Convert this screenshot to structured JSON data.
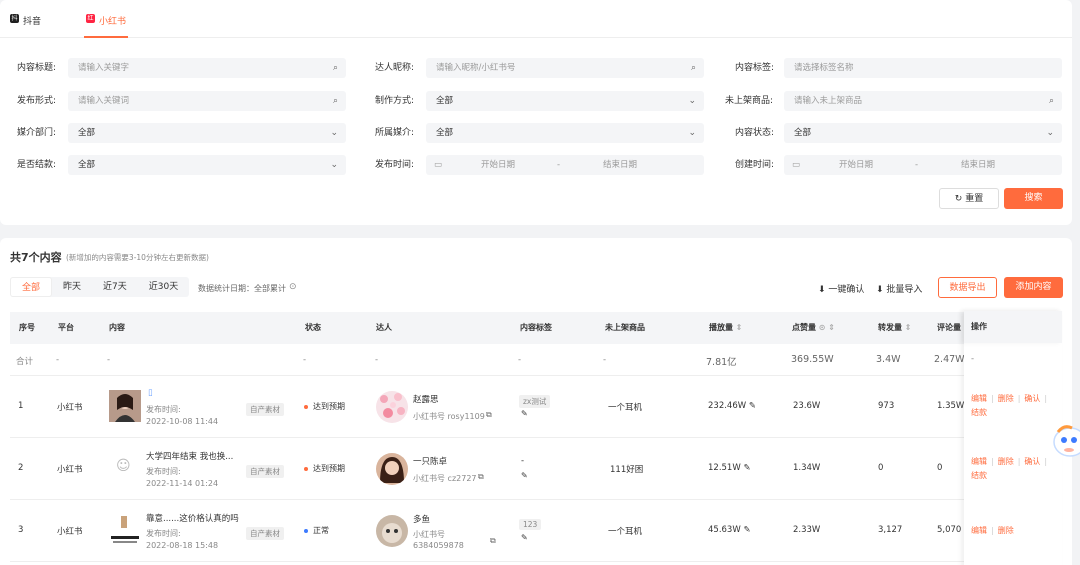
{
  "platform_tabs": [
    {
      "label": "抖音",
      "icon": "douyin-icon",
      "icon_glyph": "抖",
      "color": "#1f1f1f"
    },
    {
      "label": "小红书",
      "icon": "xiaohongshu-icon",
      "icon_glyph": "红",
      "color": "#ff2442"
    }
  ],
  "filters": {
    "content_title": {
      "label": "内容标题:",
      "placeholder": "请输入关键字"
    },
    "creator_name": {
      "label": "达人昵称:",
      "placeholder": "请输入昵称/小红书号"
    },
    "content_tag": {
      "label": "内容标签:",
      "placeholder": "请选择标签名称"
    },
    "publish_form": {
      "label": "发布形式:",
      "placeholder": "请输入关键词"
    },
    "production_method": {
      "label": "制作方式:",
      "value": "全部"
    },
    "unlisted_product": {
      "label": "未上架商品:",
      "placeholder": "请输入未上架商品"
    },
    "media_dept": {
      "label": "媒介部门:",
      "value": "全部"
    },
    "media_owner": {
      "label": "所属媒介:",
      "value": "全部"
    },
    "content_status": {
      "label": "内容状态:",
      "value": "全部"
    },
    "settled": {
      "label": "是否结款:",
      "value": "全部"
    },
    "publish_time": {
      "label": "发布时间:",
      "start": "开始日期",
      "sep": "-",
      "end": "结束日期"
    },
    "create_time": {
      "label": "创建时间:",
      "start": "开始日期",
      "sep": "-",
      "end": "结束日期"
    }
  },
  "actions": {
    "reset": "重置",
    "search": "搜索"
  },
  "summary": {
    "title": "共7个内容",
    "note": "(新增加的内容需要3-10分钟左右更新数据)"
  },
  "date_tabs": [
    "全部",
    "昨天",
    "近7天",
    "近30天"
  ],
  "stats_date": "数据统计日期：全部累计",
  "toolbar": {
    "one_click_confirm": "一键确认",
    "batch_import": "批量导入",
    "export": "数据导出",
    "add": "添加内容"
  },
  "columns": {
    "index": "序号",
    "platform": "平台",
    "content": "内容",
    "status": "状态",
    "creator": "达人",
    "tags": "内容标签",
    "unlisted": "未上架商品",
    "plays": "播放量",
    "likes": "点赞量",
    "shares": "转发量",
    "comments": "评论量",
    "ops": "操作"
  },
  "totals": {
    "label": "合计",
    "platform": "-",
    "content": "-",
    "status": "-",
    "creator": "-",
    "tags": "-",
    "unlisted": "-",
    "plays": "7.81亿",
    "likes": "369.55W",
    "shares": "3.4W",
    "comments": "2.47W",
    "ops": "-"
  },
  "rows": [
    {
      "index": "1",
      "platform": "小红书",
      "title": "",
      "publish_time": "发布时间:",
      "date": "2022-10-08 11:44",
      "source_tag": "自产素材",
      "status": "达到预期",
      "status_color": "#ff6b3d",
      "creator": "赵露思",
      "account": "小红书号 rosy1109",
      "tag": "zx测试",
      "unlisted": "一个耳机",
      "plays": "232.46W",
      "likes": "23.6W",
      "shares": "973",
      "comments": "1.35W",
      "ops": [
        "编辑",
        "删除",
        "确认",
        "结款"
      ]
    },
    {
      "index": "2",
      "platform": "小红书",
      "title": "大学四年结束 我也换...",
      "publish_time": "发布时间:",
      "date": "2022-11-14 01:24",
      "source_tag": "自产素材",
      "status": "达到预期",
      "status_color": "#ff6b3d",
      "creator": "一只陈卓",
      "account": "小红书号 cz2727",
      "tag": "-",
      "unlisted": "111好困",
      "plays": "12.51W",
      "likes": "1.34W",
      "shares": "0",
      "comments": "0",
      "ops": [
        "编辑",
        "删除",
        "确认",
        "结款"
      ]
    },
    {
      "index": "3",
      "platform": "小红书",
      "title": "靠意......这价格认真的吗",
      "publish_time": "发布时间:",
      "date": "2022-08-18 15:48",
      "source_tag": "自产素材",
      "status": "正常",
      "status_color": "#3d7bff",
      "creator": "多鱼",
      "account": "小红书号",
      "account2": "6384059878",
      "tag": "123",
      "unlisted": "一个耳机",
      "plays": "45.63W",
      "likes": "2.33W",
      "shares": "3,127",
      "comments": "5,070",
      "ops": [
        "编辑",
        "删除"
      ]
    }
  ]
}
